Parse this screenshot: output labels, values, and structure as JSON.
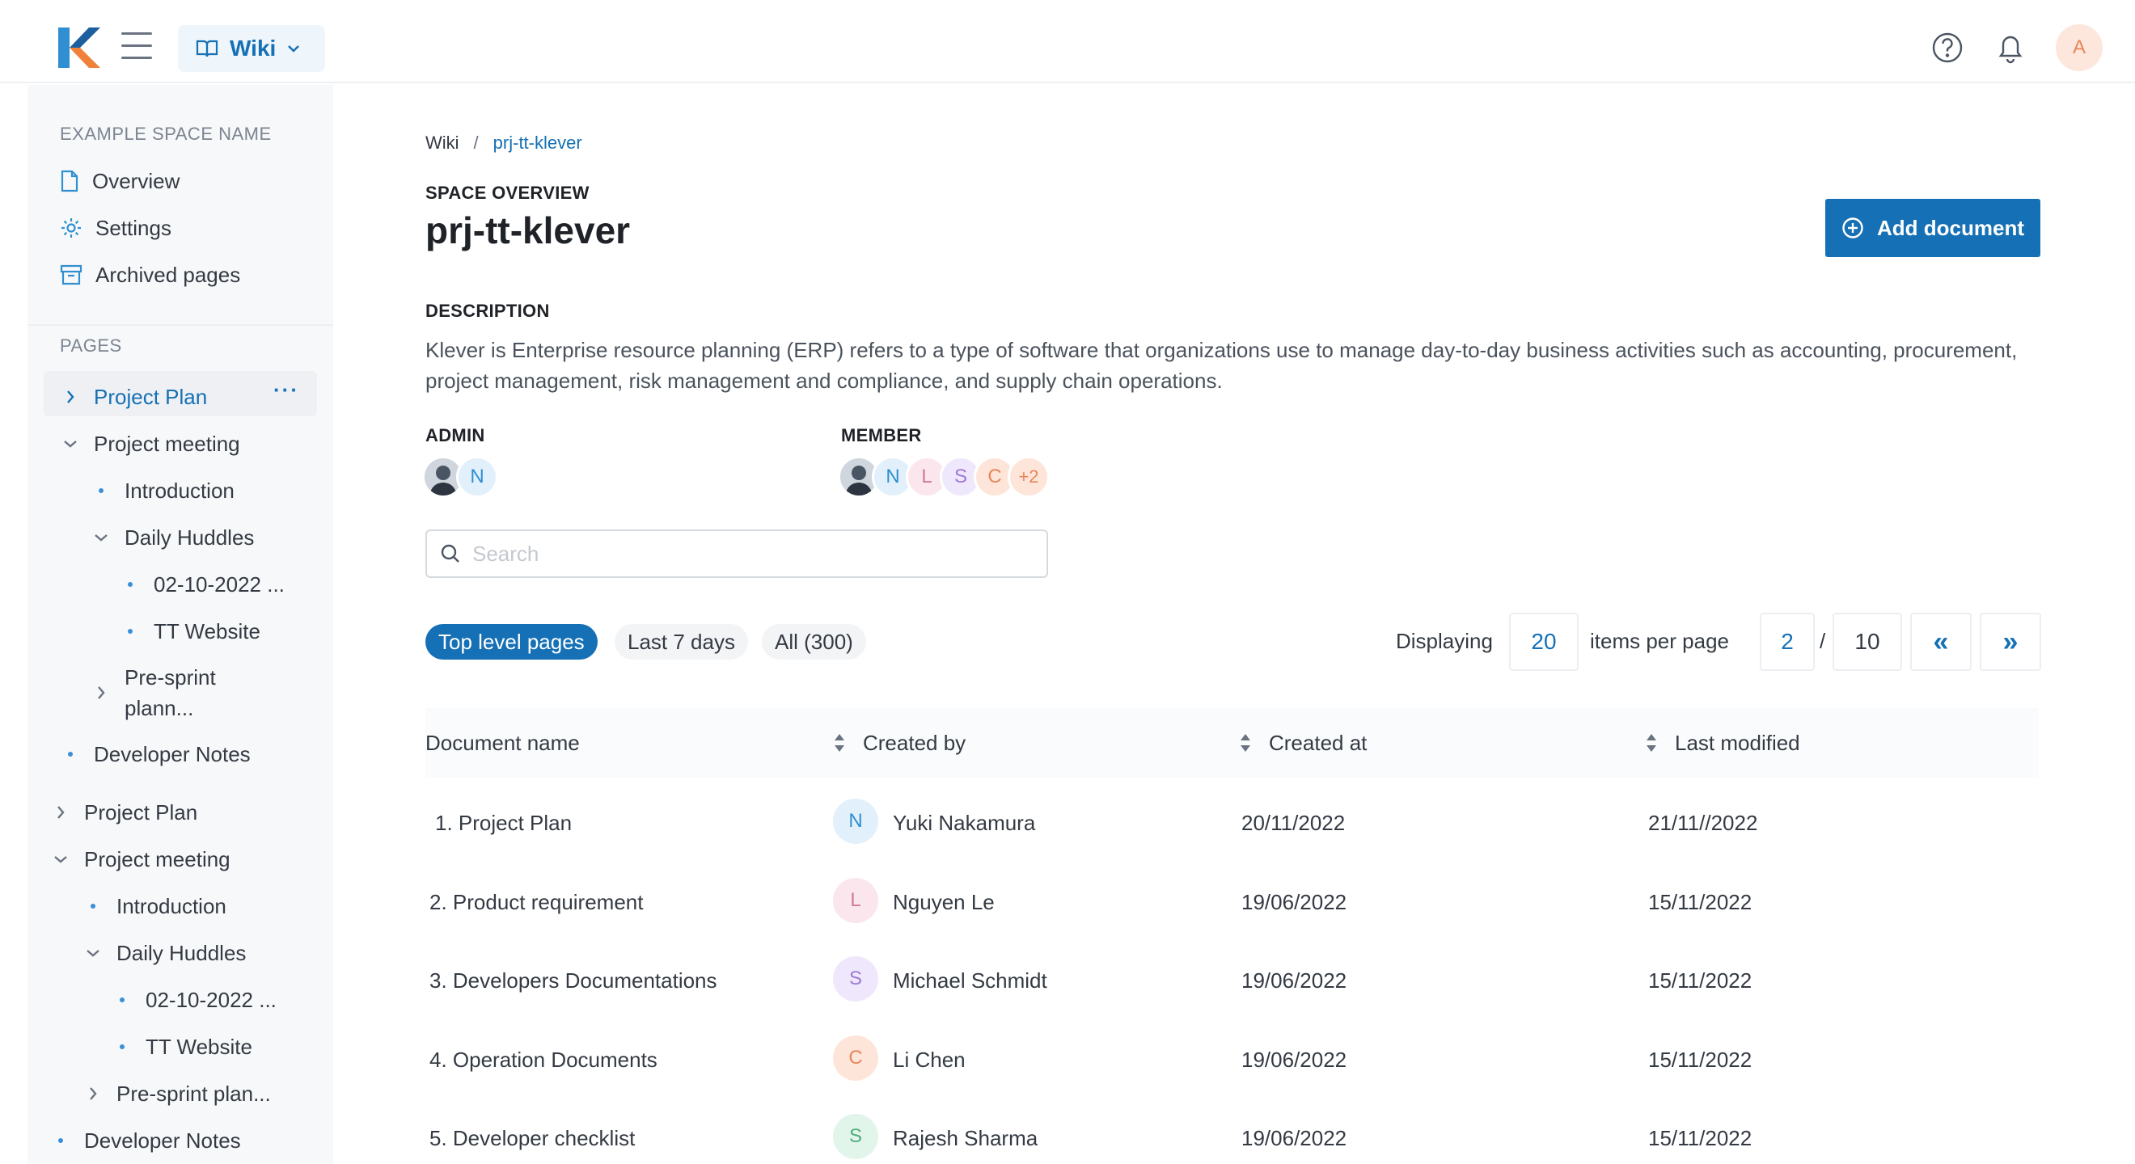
{
  "topbar": {
    "product": "Wiki",
    "user_initial": "A"
  },
  "sidebar": {
    "space_name": "EXAMPLE SPACE NAME",
    "space_items": [
      {
        "label": "Overview",
        "icon": "document-icon"
      },
      {
        "label": "Settings",
        "icon": "gear-icon"
      },
      {
        "label": "Archived pages",
        "icon": "archive-icon"
      }
    ],
    "pages_label": "PAGES",
    "tree": [
      {
        "label": "Project Plan"
      },
      {
        "label": "Project meeting"
      },
      {
        "label": "Introduction"
      },
      {
        "label": "Daily Huddles"
      },
      {
        "label": "02-10-2022 ..."
      },
      {
        "label": "TT Website"
      },
      {
        "label": "Pre-sprint",
        "label2": "plann..."
      },
      {
        "label": "Developer Notes"
      },
      {
        "label": "Project Plan"
      },
      {
        "label": "Project meeting"
      },
      {
        "label": "Introduction"
      },
      {
        "label": "Daily Huddles"
      },
      {
        "label": "02-10-2022 ..."
      },
      {
        "label": "TT Website"
      },
      {
        "label": "Pre-sprint plan..."
      },
      {
        "label": "Developer Notes"
      }
    ]
  },
  "main": {
    "breadcrumb": {
      "root": "Wiki",
      "separator": "/",
      "current": "prj-tt-klever"
    },
    "section_label": "SPACE OVERVIEW",
    "title": "prj-tt-klever",
    "add_document": "Add document",
    "description_label": "DESCRIPTION",
    "description": "Klever is Enterprise resource planning (ERP) refers to a type of software that organizations use to manage day-to-day business activities such as accounting, procurement, project management, risk management and compliance, and supply chain operations.",
    "admin_label": "ADMIN",
    "admin_avatars": [
      "N"
    ],
    "member_label": "MEMBER",
    "member_avatars": [
      "N",
      "L",
      "S",
      "C",
      "+2"
    ],
    "search_placeholder": "Search",
    "filters": [
      "Top level pages",
      "Last 7 days",
      "All (300)"
    ],
    "pager": {
      "displaying": "Displaying",
      "per_page": "20",
      "items_per_page": "items per page",
      "current": "2",
      "sep": "/",
      "total": "10",
      "prev": "«",
      "next": "»"
    },
    "table": {
      "headers": [
        "Document name",
        "Created by",
        "Created at",
        "Last modified"
      ],
      "rows": [
        {
          "name": "1. Project Plan",
          "initial": "N",
          "author": "Yuki Nakamura",
          "created": "20/11/2022",
          "modified": "21/11//2022"
        },
        {
          "name": "2. Product requirement",
          "initial": "L",
          "author": "Nguyen Le",
          "created": "19/06/2022",
          "modified": "15/11/2022"
        },
        {
          "name": "3. Developers Documentations",
          "initial": "S",
          "author": "Michael Schmidt",
          "created": "19/06/2022",
          "modified": "15/11/2022"
        },
        {
          "name": "4. Operation Documents",
          "initial": "C",
          "author": "Li Chen",
          "created": "19/06/2022",
          "modified": "15/11/2022"
        },
        {
          "name": "5. Developer checklist",
          "initial": "S",
          "author": "Rajesh Sharma",
          "created": "19/06/2022",
          "modified": "15/11/2022"
        }
      ]
    }
  },
  "colors": {
    "accent": "#1570b5",
    "avatar_n_bg": "#e1f0fb",
    "avatar_n_fg": "#2f8fd1",
    "avatar_l_bg": "#fbe6ee",
    "avatar_l_fg": "#d07a9a",
    "avatar_s_bg": "#efe7fb",
    "avatar_s_fg": "#9d7ad6",
    "avatar_c_bg": "#fde6d9",
    "avatar_c_fg": "#e8855b",
    "avatar_sgreen_bg": "#e2f5ea",
    "avatar_sgreen_fg": "#4fae7c"
  }
}
